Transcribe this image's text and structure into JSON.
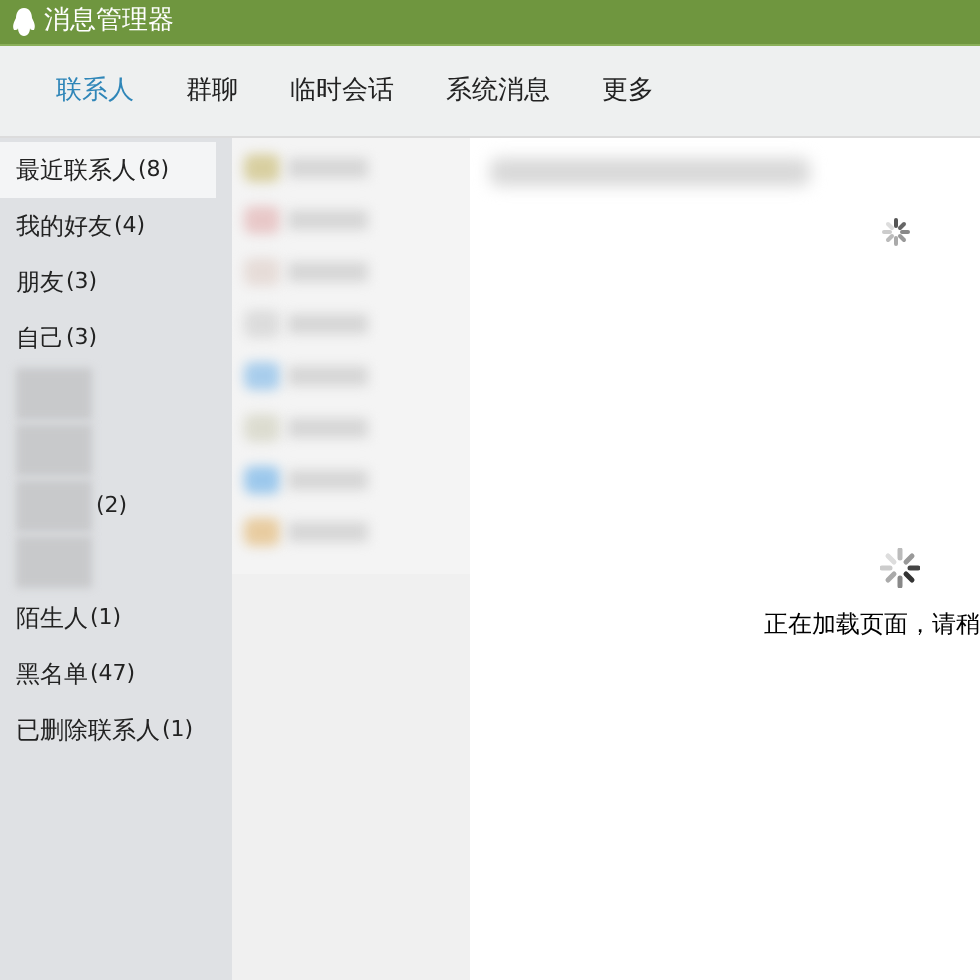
{
  "window": {
    "title": "消息管理器"
  },
  "tabs": [
    {
      "label": "联系人",
      "selected": true
    },
    {
      "label": "群聊",
      "selected": false
    },
    {
      "label": "临时会话",
      "selected": false
    },
    {
      "label": "系统消息",
      "selected": false
    },
    {
      "label": "更多",
      "selected": false
    }
  ],
  "sidebar": {
    "items": [
      {
        "kind": "text",
        "label": "最近联系人",
        "count": "(8)",
        "selected": true
      },
      {
        "kind": "text",
        "label": "我的好友",
        "count": "(4)",
        "selected": false
      },
      {
        "kind": "text",
        "label": "朋友",
        "count": "(3)",
        "selected": false
      },
      {
        "kind": "text",
        "label": "自己",
        "count": "(3)",
        "selected": false
      },
      {
        "kind": "blurred",
        "selected": false
      },
      {
        "kind": "blurred",
        "selected": false
      },
      {
        "kind": "blurred",
        "count": "(2)",
        "selected": false
      },
      {
        "kind": "blurred",
        "selected": false
      },
      {
        "kind": "text",
        "label": "陌生人",
        "count": "(1)",
        "selected": false
      },
      {
        "kind": "text",
        "label": "黑名单",
        "count": "(47)",
        "selected": false
      },
      {
        "kind": "text",
        "label": "已删除联系人",
        "count": "(1)",
        "selected": false
      }
    ]
  },
  "contacts": [
    {
      "color": "#d8cfa0"
    },
    {
      "color": "#e8c8c8"
    },
    {
      "color": "#e6dcd8"
    },
    {
      "color": "#dcdcdc"
    },
    {
      "color": "#a8cdec"
    },
    {
      "color": "#dcdcd0"
    },
    {
      "color": "#9cc8ec"
    },
    {
      "color": "#e8cca0"
    }
  ],
  "content": {
    "loading_text": "正在加载页面，请稍"
  }
}
